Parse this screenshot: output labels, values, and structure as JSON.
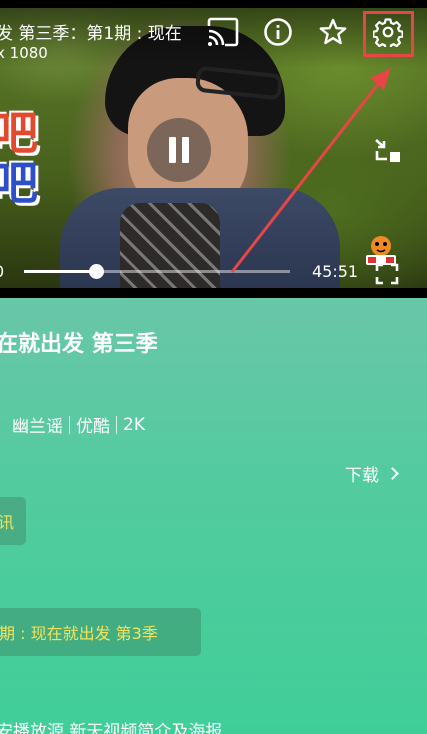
{
  "player": {
    "title": "发 第三季：第1期 : 现在",
    "resolution": "x 1080",
    "overlay_line1": "吧",
    "overlay_line2": "吧",
    "time_current": "0",
    "time_total": "45:51",
    "progress_fraction": 0.27,
    "icons": {
      "cast": "cast-icon",
      "info": "info-icon",
      "favorite": "star-icon",
      "settings": "gear-icon",
      "pause": "pause-icon",
      "collapse": "collapse-icon",
      "fullscreen": "fullscreen-icon"
    },
    "highlight_color": "#e64646"
  },
  "details": {
    "title": "在就出发 第三季",
    "meta": [
      "幽兰谣",
      "优酷",
      "2K"
    ],
    "download_label": "下载",
    "source_chip": "讯",
    "episode_chip": "期 : 现在就出发 第3季",
    "footer": "安播放源 新天视频简介及海报"
  },
  "colors": {
    "panel_top": "#69c6a8",
    "panel_bottom": "#40ce98",
    "chip_text": "#f3e35a"
  }
}
